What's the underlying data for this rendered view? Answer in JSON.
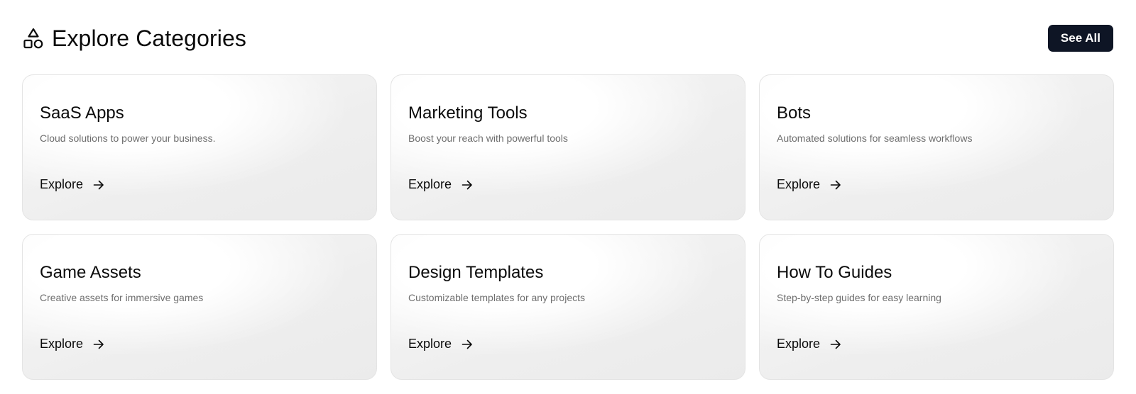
{
  "header": {
    "title": "Explore Categories",
    "title_icon": "shapes-icon",
    "see_all_label": "See All"
  },
  "colors": {
    "button_bg": "#0e1525",
    "button_text": "#ffffff",
    "title_text": "#0b0b0b",
    "desc_text": "#6e6e6e",
    "card_border": "#e4e4e4"
  },
  "categories": [
    {
      "title": "SaaS Apps",
      "description": "Cloud solutions to power your business.",
      "link_label": "Explore",
      "link_icon": "arrow-right-icon"
    },
    {
      "title": "Marketing Tools",
      "description": "Boost your reach with powerful tools",
      "link_label": "Explore",
      "link_icon": "arrow-right-icon"
    },
    {
      "title": "Bots",
      "description": "Automated solutions for seamless workflows",
      "link_label": "Explore",
      "link_icon": "arrow-right-icon"
    },
    {
      "title": "Game Assets",
      "description": "Creative assets for immersive games",
      "link_label": "Explore",
      "link_icon": "arrow-right-icon"
    },
    {
      "title": "Design Templates",
      "description": "Customizable templates for any projects",
      "link_label": "Explore",
      "link_icon": "arrow-right-icon"
    },
    {
      "title": "How To Guides",
      "description": "Step-by-step guides for easy learning",
      "link_label": "Explore",
      "link_icon": "arrow-right-icon"
    }
  ]
}
